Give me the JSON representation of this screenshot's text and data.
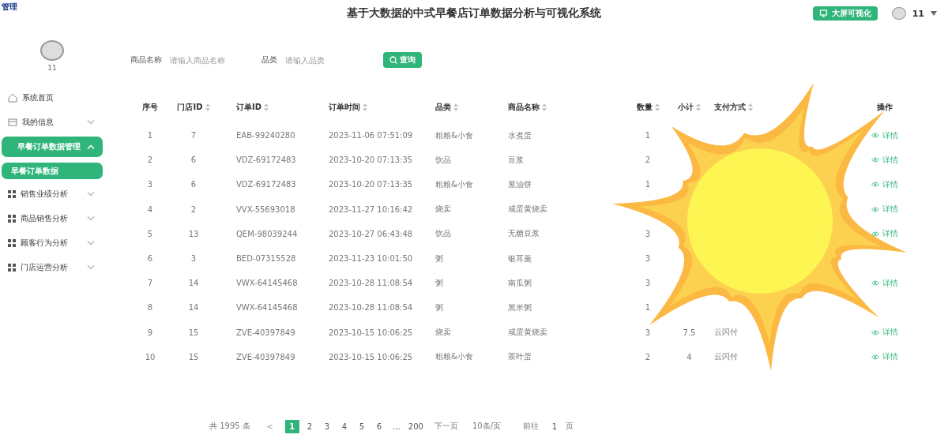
{
  "app": {
    "logo": "管理",
    "title": "基于大数据的中式早餐店订单数据分析与可视化系统"
  },
  "header_actions": {
    "screen_button": "大屏可视化",
    "user": "11"
  },
  "sidebar": {
    "user": "11",
    "items": [
      {
        "label": "系统首页",
        "selected": false
      },
      {
        "label": "我的信息",
        "selected": false,
        "expanded": false
      },
      {
        "label": "早餐订单数据管理",
        "selected": true,
        "expanded": true,
        "children": [
          {
            "label": "早餐订单数据",
            "selected": true
          }
        ]
      },
      {
        "label": "销售业绩分析",
        "selected": false,
        "expanded": false
      },
      {
        "label": "商品销售分析",
        "selected": false,
        "expanded": false
      },
      {
        "label": "顾客行为分析",
        "selected": false,
        "expanded": false
      },
      {
        "label": "门店运营分析",
        "selected": false,
        "expanded": false
      }
    ]
  },
  "filters": [
    {
      "label": "商品名称",
      "placeholder": "请输入商品名称"
    },
    {
      "label": "品类",
      "placeholder": "请输入品类"
    }
  ],
  "search_button": "查询",
  "table": {
    "columns": [
      {
        "label": "序号",
        "sortable": false,
        "kind": "text"
      },
      {
        "label": "门店ID",
        "sortable": true,
        "kind": "text"
      },
      {
        "label": "订单ID",
        "sortable": true,
        "kind": "text"
      },
      {
        "label": "订单时间",
        "sortable": true,
        "kind": "text"
      },
      {
        "label": "品类",
        "sortable": true,
        "kind": "text"
      },
      {
        "label": "商品名称",
        "sortable": true,
        "kind": "text"
      },
      {
        "label": "数量",
        "sortable": true,
        "kind": "text"
      },
      {
        "label": "小计",
        "sortable": true,
        "kind": "text"
      },
      {
        "label": "支付方式",
        "sortable": true,
        "kind": "text"
      },
      {
        "label": "操作",
        "sortable": false,
        "kind": "action"
      }
    ],
    "rows": [
      [
        "1",
        "7",
        "EAB-99240280",
        "2023-11-06 07:51:09",
        "粗粮&小食",
        "水煮蛋",
        "1",
        null,
        null,
        "详情"
      ],
      [
        "2",
        "6",
        "VDZ-69172483",
        "2023-10-20 07:13:35",
        "饮品",
        "豆浆",
        "2",
        null,
        null,
        "详情"
      ],
      [
        "3",
        "6",
        "VDZ-69172483",
        "2023-10-20 07:13:35",
        "粗粮&小食",
        "葱油饼",
        "1",
        null,
        null,
        "详情"
      ],
      [
        "4",
        "2",
        "VVX-55693018",
        "2023-11-27 10:16:42",
        "烧卖",
        "咸蛋黄烧卖",
        null,
        null,
        null,
        "详情"
      ],
      [
        "5",
        "13",
        "QEM-98039244",
        "2023-10-27 06:43:48",
        "饮品",
        "无糖豆浆",
        "3",
        null,
        null,
        "详情"
      ],
      [
        "6",
        "3",
        "BED-07315528",
        "2023-11-23 10:01:50",
        "粥",
        "银耳羹",
        "3",
        null,
        null,
        null
      ],
      [
        "7",
        "14",
        "VWX-64145468",
        "2023-10-28 11:08:54",
        "粥",
        "南瓜粥",
        "3",
        null,
        null,
        "详情"
      ],
      [
        "8",
        "14",
        "VWX-64145468",
        "2023-10-28 11:08:54",
        "粥",
        "黑米粥",
        "1",
        null,
        null,
        null
      ],
      [
        "9",
        "15",
        "ZVE-40397849",
        "2023-10-15 10:06:25",
        "烧卖",
        "咸蛋黄烧卖",
        "3",
        "7.5",
        "云闪付",
        "详情"
      ],
      [
        "10",
        "15",
        "ZVE-40397849",
        "2023-10-15 10:06:25",
        "粗粮&小食",
        "茶叶蛋",
        "2",
        "4",
        "云闪付",
        "详情"
      ]
    ]
  },
  "pagination": {
    "total": "共 1995 条",
    "prev": "<",
    "pages": [
      {
        "label": "1",
        "selected": true
      },
      {
        "label": "2",
        "selected": false
      },
      {
        "label": "3",
        "selected": false
      },
      {
        "label": "4",
        "selected": false
      },
      {
        "label": "5",
        "selected": false
      },
      {
        "label": "6",
        "selected": false
      },
      {
        "label": "...",
        "selected": false
      },
      {
        "label": "200",
        "selected": false
      }
    ],
    "next": "下一页",
    "page_size": "10条/页",
    "goto_label": "前往",
    "goto_value": "1",
    "goto_suffix": "页"
  }
}
